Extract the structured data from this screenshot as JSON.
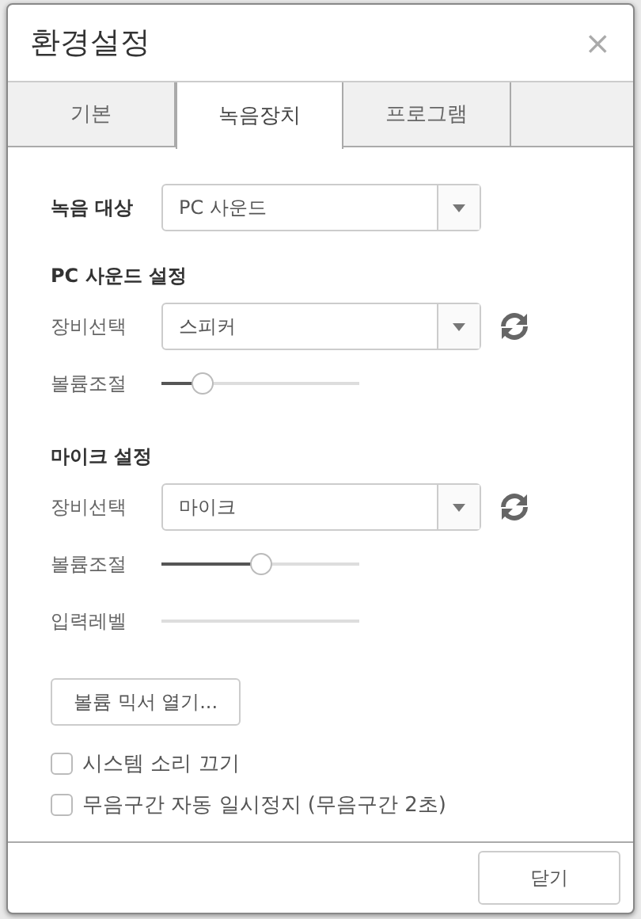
{
  "window": {
    "title": "환경설정",
    "close": "×"
  },
  "tabs": [
    {
      "label": "기본",
      "selected": false
    },
    {
      "label": "녹음장치",
      "selected": true
    },
    {
      "label": "프로그램",
      "selected": false
    }
  ],
  "record_target": {
    "label": "녹음 대상",
    "value": "PC 사운드"
  },
  "sections": [
    {
      "title": "PC 사운드 설정",
      "rows": [
        {
          "kind": "select",
          "label": "장비선택",
          "value": "스피커"
        },
        {
          "kind": "slider",
          "label": "볼륨조절",
          "level": 0.21
        }
      ]
    },
    {
      "title": "마이크 설정",
      "rows": [
        {
          "kind": "select",
          "label": "장비선택",
          "value": "마이크"
        },
        {
          "kind": "slider",
          "label": "볼륨조절",
          "level": 0.5
        },
        {
          "kind": "meter",
          "label": "입력레벨",
          "level": 0
        }
      ]
    }
  ],
  "mixer_button": "볼륨 믹서 열기...",
  "options": [
    {
      "label": "시스템 소리 끄기",
      "checked": false
    },
    {
      "label": "무음구간 자동 일시정지 (무음구간 2초)",
      "checked": false
    }
  ],
  "close_button": "닫기"
}
